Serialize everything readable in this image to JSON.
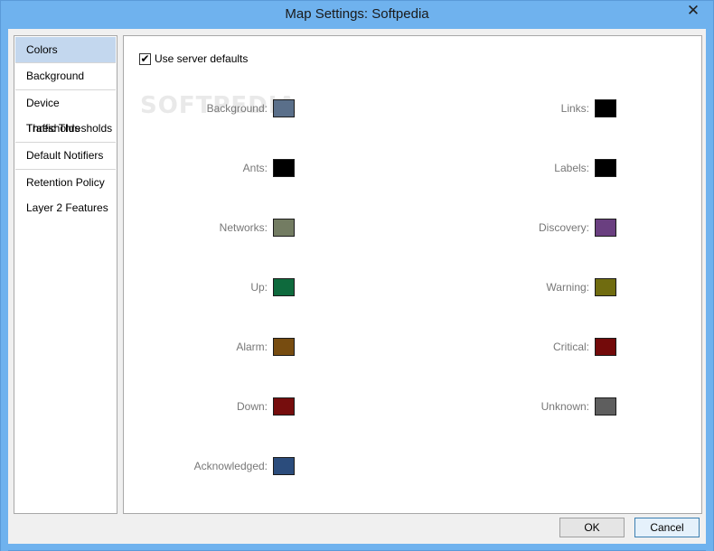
{
  "window": {
    "title": "Map Settings: Softpedia",
    "close_glyph": "✕"
  },
  "sidebar": {
    "items": [
      {
        "label": "Colors"
      },
      {
        "label": "Background"
      },
      {
        "label": "Device Thresholds"
      },
      {
        "label": "Traffic Thresholds"
      },
      {
        "label": "Default Notifiers"
      },
      {
        "label": "Retention Policy"
      },
      {
        "label": "Layer 2 Features"
      }
    ],
    "selected": "Colors"
  },
  "panel": {
    "use_server_defaults": {
      "label": "Use server defaults",
      "checked": true,
      "check_glyph": "✔"
    },
    "watermark": "SOFTPEDIA",
    "left_colors": [
      {
        "label": "Background:",
        "color": "#5a6f8a"
      },
      {
        "label": "Ants:",
        "color": "#000000"
      },
      {
        "label": "Networks:",
        "color": "#737c62"
      },
      {
        "label": "Up:",
        "color": "#0e6a3d"
      },
      {
        "label": "Alarm:",
        "color": "#774c10"
      },
      {
        "label": "Down:",
        "color": "#760d0d"
      },
      {
        "label": "Acknowledged:",
        "color": "#2b4c7c"
      }
    ],
    "right_colors": [
      {
        "label": "Links:",
        "color": "#000000"
      },
      {
        "label": "Labels:",
        "color": "#000000"
      },
      {
        "label": "Discovery:",
        "color": "#6a3f80"
      },
      {
        "label": "Warning:",
        "color": "#706c10"
      },
      {
        "label": "Critical:",
        "color": "#730a0a"
      },
      {
        "label": "Unknown:",
        "color": "#5e5e5e"
      }
    ]
  },
  "buttons": {
    "ok": "OK",
    "cancel": "Cancel"
  }
}
